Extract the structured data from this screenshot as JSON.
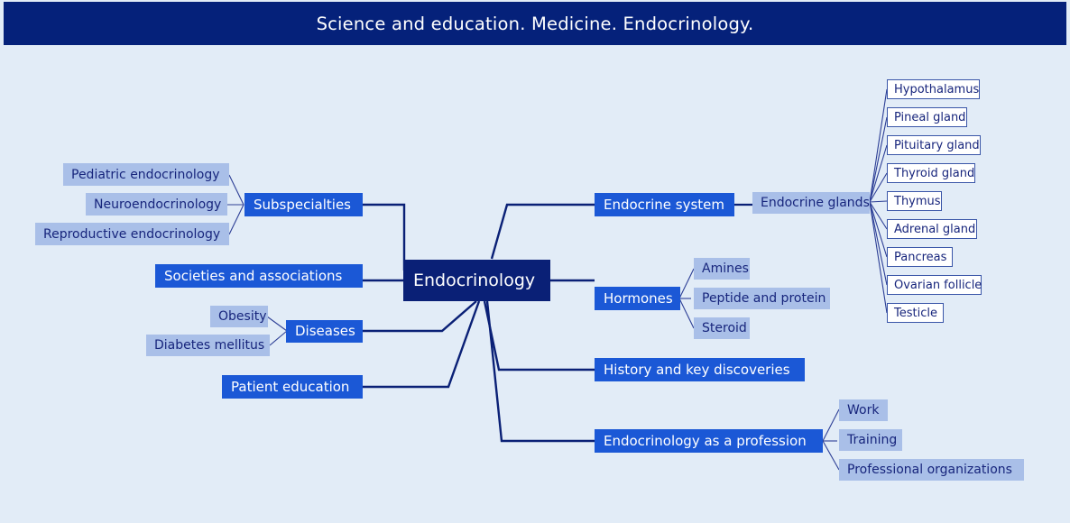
{
  "title": "Science and education. Medicine. Endocrinology.",
  "colors": {
    "background": "#e2ecf7",
    "title_bar": "#05217a",
    "root_fill": "#0a2076",
    "level1_fill": "#1b58d6",
    "level2_fill": "#a9bfe8",
    "level3_fill": "#ffffff",
    "level3_border": "#3a56a8",
    "edge": "#0a2076",
    "text_light": "#ffffff",
    "text_dark": "#17257c"
  },
  "root": {
    "label": "Endocrinology"
  },
  "nodes": {
    "subspecialties": "Subspecialties",
    "pediatric_endocrinology": "Pediatric endocrinology",
    "neuroendocrinology": "Neuroendocrinology",
    "reproductive_endocrinology": "Reproductive endocrinology",
    "societies_and_associations": "Societies and associations",
    "diseases": "Diseases",
    "obesity": "Obesity",
    "diabetes_mellitus": "Diabetes mellitus",
    "patient_education": "Patient education",
    "endocrine_system": "Endocrine system",
    "endocrine_glands": "Endocrine glands",
    "hypothalamus": "Hypothalamus",
    "pineal_gland": "Pineal gland",
    "pituitary_gland": "Pituitary gland",
    "thyroid_gland": "Thyroid gland",
    "thymus": "Thymus",
    "adrenal_gland": "Adrenal gland",
    "pancreas": "Pancreas",
    "ovarian_follicle": "Ovarian follicle",
    "testicle": "Testicle",
    "hormones": "Hormones",
    "amines": "Amines",
    "peptide_and_protein": "Peptide and protein",
    "steroid": "Steroid",
    "history_and_key_discoveries": "History and key discoveries",
    "endocrinology_as_a_profession": "Endocrinology as a profession",
    "work": "Work",
    "training": "Training",
    "professional_organizations": "Professional organizations"
  },
  "tree": {
    "label": "Endocrinology",
    "children": [
      {
        "label": "Subspecialties",
        "children": [
          {
            "label": "Pediatric endocrinology"
          },
          {
            "label": "Neuroendocrinology"
          },
          {
            "label": "Reproductive endocrinology"
          }
        ]
      },
      {
        "label": "Societies and associations"
      },
      {
        "label": "Diseases",
        "children": [
          {
            "label": "Obesity"
          },
          {
            "label": "Diabetes mellitus"
          }
        ]
      },
      {
        "label": "Patient education"
      },
      {
        "label": "Endocrine system",
        "children": [
          {
            "label": "Endocrine glands",
            "children": [
              {
                "label": "Hypothalamus"
              },
              {
                "label": "Pineal gland"
              },
              {
                "label": "Pituitary gland"
              },
              {
                "label": "Thyroid gland"
              },
              {
                "label": "Thymus"
              },
              {
                "label": "Adrenal gland"
              },
              {
                "label": "Pancreas"
              },
              {
                "label": "Ovarian follicle"
              },
              {
                "label": "Testicle"
              }
            ]
          }
        ]
      },
      {
        "label": "Hormones",
        "children": [
          {
            "label": "Amines"
          },
          {
            "label": "Peptide and protein"
          },
          {
            "label": "Steroid"
          }
        ]
      },
      {
        "label": "History and key discoveries"
      },
      {
        "label": "Endocrinology as a profession",
        "children": [
          {
            "label": "Work"
          },
          {
            "label": "Training"
          },
          {
            "label": "Professional organizations"
          }
        ]
      }
    ]
  }
}
